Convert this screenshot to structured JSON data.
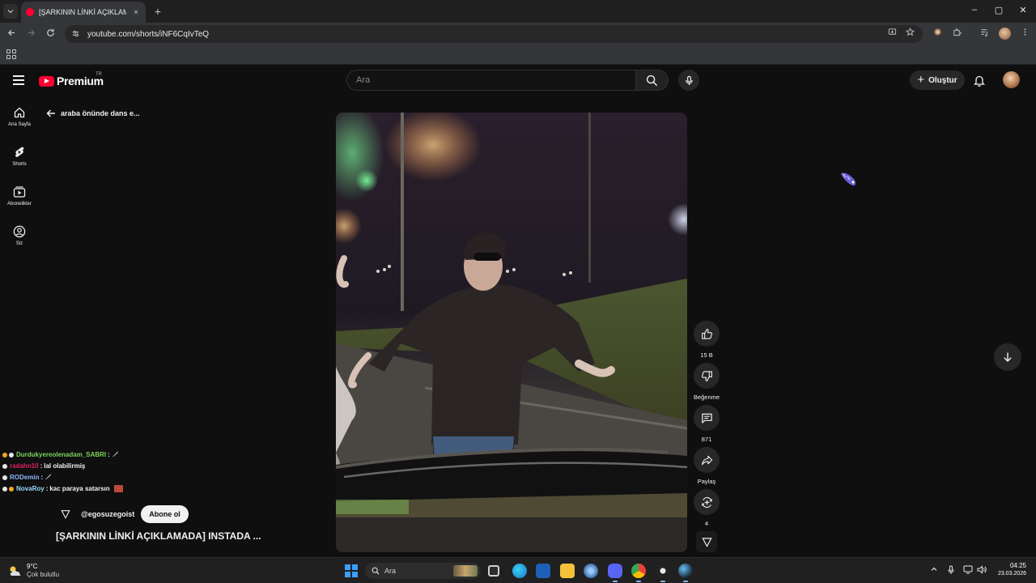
{
  "browser": {
    "tab_title": "[ŞARKININ LİNKİ AÇIKLAMADA]",
    "tab_close": "×",
    "new_tab": "+",
    "url": "youtube.com/shorts/iNF6CqIvTeQ",
    "window_controls": [
      "–",
      "▢",
      "✕"
    ]
  },
  "youtube": {
    "logo_text": "Premium",
    "country_code": "TR",
    "search_placeholder": "Ara",
    "create_label": "Oluştur",
    "guide": [
      {
        "label": "Ana Sayfa",
        "icon": "home-icon"
      },
      {
        "label": "Shorts",
        "icon": "shorts-icon"
      },
      {
        "label": "Abonelikler",
        "icon": "subscriptions-icon"
      },
      {
        "label": "Siz",
        "icon": "you-icon"
      }
    ],
    "short_title_top": "araba önünde dans e...",
    "actions": {
      "like_count": "15 B",
      "dislike_label": "Beğenme",
      "comment_count": "871",
      "share_label": "Paylaş",
      "remix_count": "4"
    },
    "channel": {
      "handle": "@egosuzegoist",
      "subscribe_label": "Abone ol"
    },
    "caption": "[ŞARKININ LİNKİ AÇIKLAMADA] INSTADA ..."
  },
  "chat": [
    {
      "user": "Durdukyereolenadam_SABRI",
      "message": "",
      "color": "#7cd35a",
      "badge_color": "#f5a623"
    },
    {
      "user": "radahn10",
      "message": "lal olabilirmiş",
      "color": "#e0245e",
      "badge_color": "#e6e6e6"
    },
    {
      "user": "RODemin",
      "message": "",
      "color": "#8ab4f8",
      "badge_color": "#e6e6e6"
    },
    {
      "user": "NovaRoy",
      "message": "kac paraya satarsın",
      "color": "#9ad8ff",
      "badge_color": "#f5a623"
    }
  ],
  "chat_separator": " : ",
  "taskbar": {
    "weather_temp": "9°C",
    "weather_desc": "Çok bulutlu",
    "search_label": "Ara",
    "time": "04:25",
    "date": "23.03.2026"
  },
  "colors": {
    "accent": "#ff0033",
    "page_bg": "#0f0f0f",
    "chip_bg": "#272727"
  }
}
